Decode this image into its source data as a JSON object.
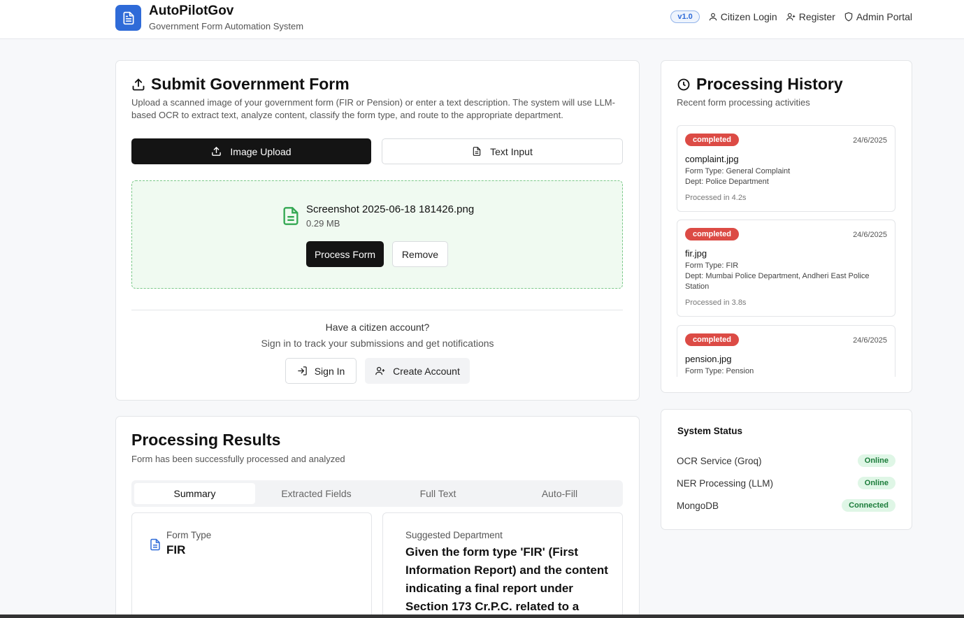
{
  "header": {
    "app_title": "AutoPilotGov",
    "app_subtitle": "Government Form Automation System",
    "version": "v1.0",
    "nav": {
      "citizen_login": "Citizen Login",
      "register": "Register",
      "admin_portal": "Admin Portal"
    }
  },
  "submit": {
    "title": "Submit Government Form",
    "description": "Upload a scanned image of your government form (FIR or Pension) or enter a text description. The system will use LLM-based OCR to extract text, analyze content, classify the form type, and route to the appropriate department.",
    "tabs": {
      "image_upload": "Image Upload",
      "text_input": "Text Input"
    },
    "file": {
      "name": "Screenshot 2025-06-18 181426.png",
      "size": "0.29 MB"
    },
    "process_button": "Process Form",
    "remove_button": "Remove",
    "account_prompt": "Have a citizen account?",
    "account_sub": "Sign in to track your submissions and get notifications",
    "sign_in": "Sign In",
    "create_account": "Create Account"
  },
  "history": {
    "title": "Processing History",
    "subtitle": "Recent form processing activities",
    "items": [
      {
        "status": "completed",
        "date": "24/6/2025",
        "name": "complaint.jpg",
        "form_type": "Form Type: General Complaint",
        "dept": "Dept: Police Department",
        "time": "Processed in 4.2s"
      },
      {
        "status": "completed",
        "date": "24/6/2025",
        "name": "fir.jpg",
        "form_type": "Form Type: FIR",
        "dept": "Dept: Mumbai Police Department, Andheri East Police Station",
        "time": "Processed in 3.8s"
      },
      {
        "status": "completed",
        "date": "24/6/2025",
        "name": "pension.jpg",
        "form_type": "Form Type: Pension"
      }
    ]
  },
  "system_status": {
    "title": "System Status",
    "items": [
      {
        "label": "OCR Service (Groq)",
        "status": "Online"
      },
      {
        "label": "NER Processing (LLM)",
        "status": "Online"
      },
      {
        "label": "MongoDB",
        "status": "Connected"
      }
    ]
  },
  "results": {
    "title": "Processing Results",
    "subtitle": "Form has been successfully processed and analyzed",
    "tabs": [
      "Summary",
      "Extracted Fields",
      "Full Text",
      "Auto-Fill"
    ],
    "form_type_label": "Form Type",
    "form_type_value": "FIR",
    "dept_label": "Suggested Department",
    "dept_value": "Given the form type 'FIR' (First Information Report) and the content indicating a final report under Section 173 Cr.P.C. related to a"
  }
}
